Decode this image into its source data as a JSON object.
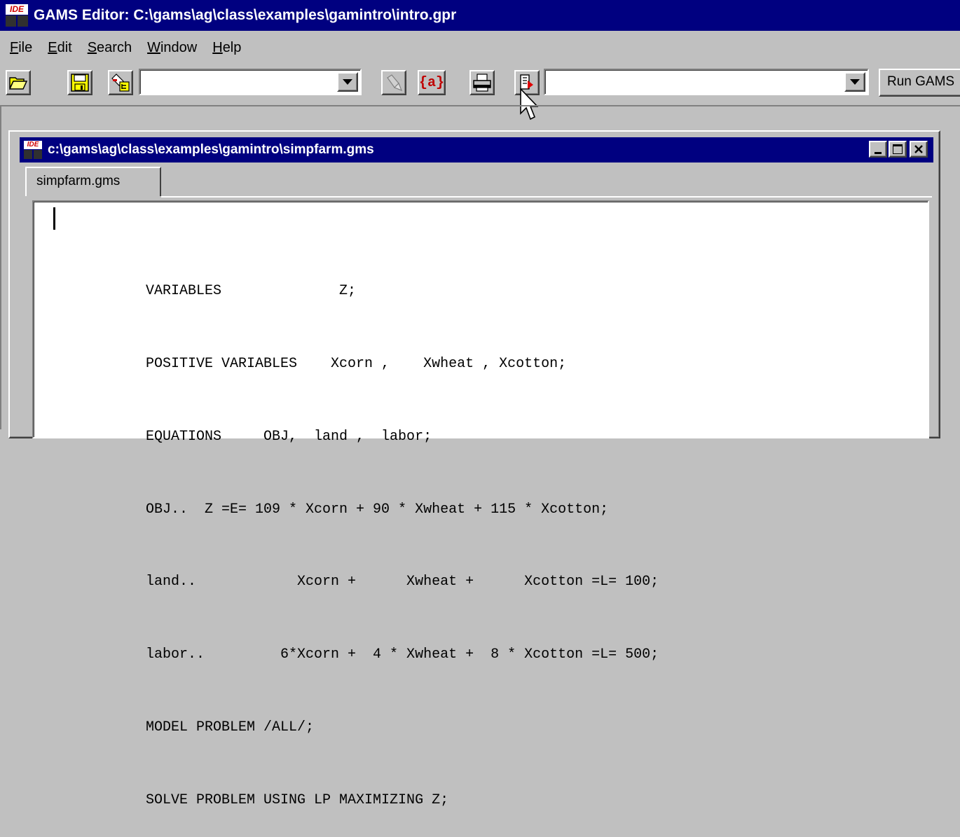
{
  "window": {
    "title": "GAMS Editor: C:\\gams\\ag\\class\\examples\\gamintro\\intro.gpr",
    "logo_text": "IDE"
  },
  "menu": [
    {
      "label": "File",
      "u": "F",
      "rest": "ile"
    },
    {
      "label": "Edit",
      "u": "E",
      "rest": "dit"
    },
    {
      "label": "Search",
      "u": "S",
      "rest": "earch"
    },
    {
      "label": "Window",
      "u": "W",
      "rest": "indow"
    },
    {
      "label": "Help",
      "u": "H",
      "rest": "elp"
    }
  ],
  "toolbar": {
    "open_icon": "folder-open-icon",
    "save_icon": "floppy-disk-icon",
    "project_icon": "project-tree-icon",
    "search_combo_value": "",
    "find_icon": "flashlight-icon",
    "matching_paren_label": "{a}",
    "print_icon": "printer-icon",
    "run_icon": "run-document-icon",
    "model_combo_value": "",
    "run_gams_label": "Run GAMS"
  },
  "document": {
    "title": "c:\\gams\\ag\\class\\examples\\gamintro\\simpfarm.gms",
    "tab_label": "simpfarm.gms",
    "code_lines": [
      "VARIABLES              Z;",
      "POSITIVE VARIABLES    Xcorn ,    Xwheat , Xcotton;",
      "EQUATIONS     OBJ,  land ,  labor;",
      "OBJ..  Z =E= 109 * Xcorn + 90 * Xwheat + 115 * Xcotton;",
      "land..            Xcorn +      Xwheat +      Xcotton =L= 100;",
      "labor..         6*Xcorn +  4 * Xwheat +  8 * Xcotton =L= 500;",
      "MODEL PROBLEM /ALL/;",
      "SOLVE PROBLEM USING LP MAXIMIZING Z;"
    ]
  },
  "colors": {
    "titlebar": "#000080",
    "face": "#c0c0c0",
    "editor_bg": "#ffffff"
  }
}
